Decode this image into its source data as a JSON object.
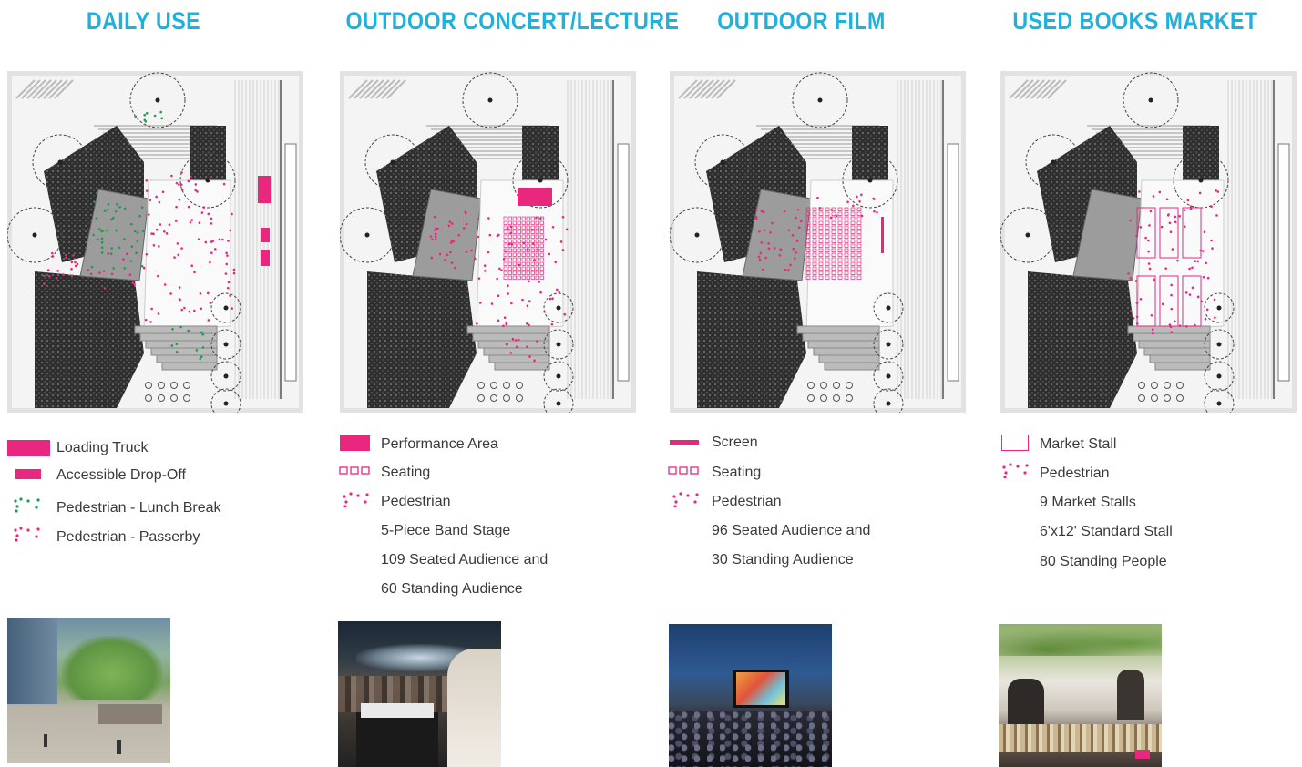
{
  "columns": [
    {
      "title": "DAILY USE",
      "legend": [
        {
          "icon": "loading-truck-swatch",
          "label": "Loading Truck"
        },
        {
          "icon": "drop-off-swatch",
          "label": "Accessible Drop-Off"
        },
        {
          "icon": "green-dots-icon",
          "label": "Pedestrian - Lunch Break"
        },
        {
          "icon": "pink-dots-icon",
          "label": "Pedestrian - Passerby"
        }
      ],
      "notes": []
    },
    {
      "title": "OUTDOOR CONCERT/LECTURE",
      "legend": [
        {
          "icon": "performance-area-swatch",
          "label": "Performance Area"
        },
        {
          "icon": "seating-squares-icon",
          "label": "Seating"
        },
        {
          "icon": "pink-dots-icon",
          "label": "Pedestrian"
        }
      ],
      "notes": [
        "5-Piece Band Stage",
        "109 Seated Audience and",
        "60 Standing Audience"
      ]
    },
    {
      "title": "OUTDOOR FILM",
      "legend": [
        {
          "icon": "screen-line-icon",
          "label": "Screen"
        },
        {
          "icon": "seating-squares-icon",
          "label": "Seating"
        },
        {
          "icon": "pink-dots-icon",
          "label": "Pedestrian"
        }
      ],
      "notes": [
        "96 Seated Audience and",
        "30 Standing Audience"
      ]
    },
    {
      "title": "USED BOOKS MARKET",
      "legend": [
        {
          "icon": "market-stall-outline-icon",
          "label": "Market Stall"
        },
        {
          "icon": "pink-dots-icon",
          "label": "Pedestrian"
        }
      ],
      "notes": [
        "9 Market Stalls",
        "6'x12' Standard Stall",
        "80 Standing People"
      ]
    }
  ],
  "colors": {
    "title": "#1fb0dc",
    "accent_pink": "#e8277f",
    "accent_green": "#1f9b4a",
    "plan_gray": "#9c9c9c",
    "plan_dark": "#3a3a3a"
  }
}
